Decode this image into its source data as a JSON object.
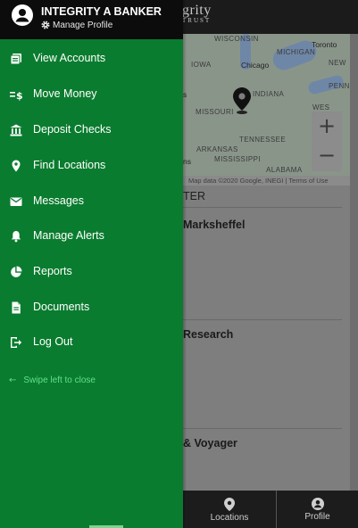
{
  "brand": {
    "line1": "grity",
    "line2": "TRUST"
  },
  "user": {
    "name": "INTEGRITY A BANKER",
    "manage_profile": "Manage Profile"
  },
  "menu": [
    {
      "label": "View Accounts",
      "icon": "accounts-icon"
    },
    {
      "label": "Move Money",
      "icon": "transfer-money-icon"
    },
    {
      "label": "Deposit Checks",
      "icon": "bank-icon"
    },
    {
      "label": "Find Locations",
      "icon": "location-pin-icon"
    },
    {
      "label": "Messages",
      "icon": "mail-icon"
    },
    {
      "label": "Manage Alerts",
      "icon": "bell-icon"
    },
    {
      "label": "Reports",
      "icon": "pie-chart-icon"
    },
    {
      "label": "Documents",
      "icon": "document-icon"
    },
    {
      "label": "Log Out",
      "icon": "logout-icon"
    }
  ],
  "swipe_hint": "Swipe left to close",
  "map": {
    "labels": [
      "WISCONSIN",
      "Toronto",
      "Chicago",
      "INDIANA",
      "MISSOURI",
      "TENNESSEE",
      "ARKANSAS",
      "MISSISSIPPI",
      "ALABAMA",
      "NEW",
      "PENN",
      "WES",
      "IOWA",
      "MICHIGAN",
      "s",
      "ns"
    ],
    "attribution": "Map data ©2020 Google, INEGI",
    "terms": "Terms of Use",
    "zoom_in": "+",
    "zoom_out": "−"
  },
  "background": {
    "section_header": "TER",
    "items": [
      "Marksheffel",
      "Research",
      "& Voyager"
    ]
  },
  "bottom_nav": {
    "locations": "Locations",
    "profile": "Profile"
  },
  "colors": {
    "drawer": "#0a7c2f",
    "header": "#0c0c0c",
    "swipe_hint": "#5ee08a"
  }
}
